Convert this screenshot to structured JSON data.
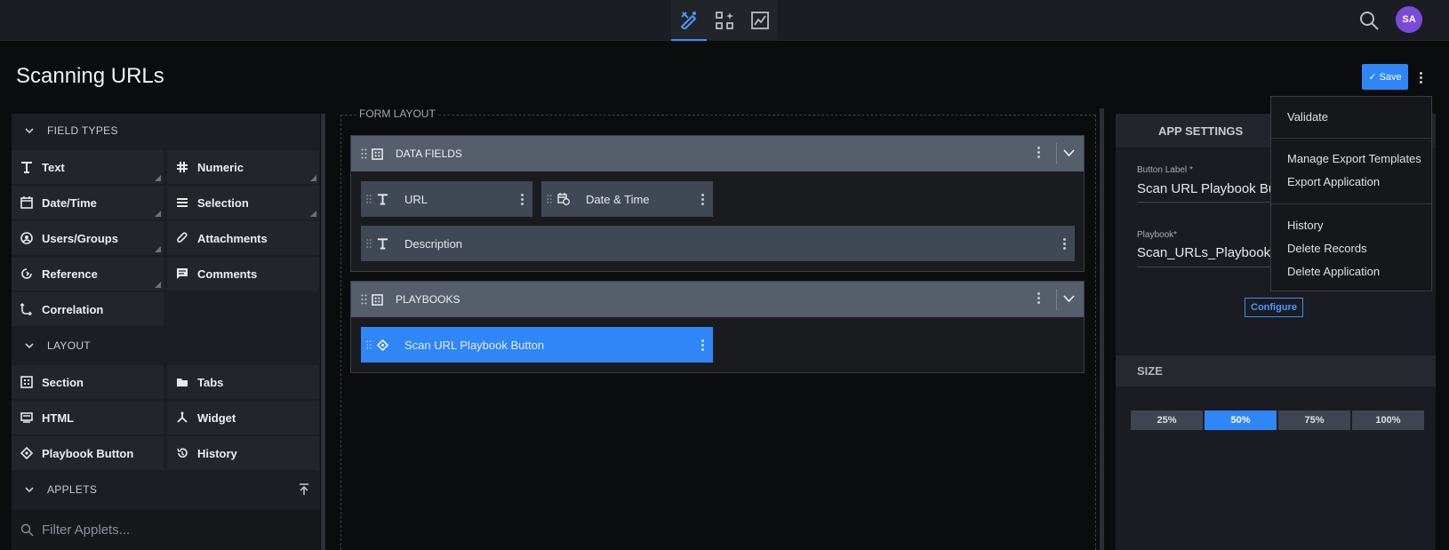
{
  "header": {
    "nav_icons": [
      "form-designer-icon",
      "workflow-icon",
      "reports-icon"
    ],
    "avatar_initials": "SA"
  },
  "page": {
    "title": "Scanning URLs",
    "save_label": "Save"
  },
  "palette": {
    "field_types_label": "FIELD TYPES",
    "field_types": [
      {
        "label": "Text",
        "icon": "text-icon"
      },
      {
        "label": "Numeric",
        "icon": "hash-icon"
      },
      {
        "label": "Date/Time",
        "icon": "calendar-icon"
      },
      {
        "label": "Selection",
        "icon": "list-icon"
      },
      {
        "label": "Users/Groups",
        "icon": "user-icon"
      },
      {
        "label": "Attachments",
        "icon": "paperclip-icon"
      },
      {
        "label": "Reference",
        "icon": "reference-icon"
      },
      {
        "label": "Comments",
        "icon": "comment-icon"
      },
      {
        "label": "Correlation",
        "icon": "correlation-icon"
      }
    ],
    "layout_label": "LAYOUT",
    "layout_items": [
      {
        "label": "Section",
        "icon": "section-icon"
      },
      {
        "label": "Tabs",
        "icon": "tabs-icon"
      },
      {
        "label": "HTML",
        "icon": "html-icon"
      },
      {
        "label": "Widget",
        "icon": "widget-icon"
      },
      {
        "label": "Playbook Button",
        "icon": "playbook-icon"
      },
      {
        "label": "History",
        "icon": "history-icon"
      }
    ],
    "applets_label": "APPLETS",
    "filter_placeholder": "Filter Applets..."
  },
  "form": {
    "label": "FORM LAYOUT",
    "sections": [
      {
        "title": "DATA FIELDS",
        "fields": [
          {
            "label": "URL",
            "icon": "text-icon"
          },
          {
            "label": "Date & Time",
            "icon": "calendar-clock-icon"
          },
          {
            "label": "Description",
            "icon": "text-icon"
          }
        ]
      },
      {
        "title": "PLAYBOOKS",
        "fields": [
          {
            "label": "Scan URL Playbook Button",
            "icon": "playbook-icon",
            "selected": true
          }
        ]
      }
    ]
  },
  "settings": {
    "title": "APP SETTINGS",
    "button_label_label": "Button Label",
    "button_label_required": "*",
    "button_label_value": "Scan URL Playbook Butt",
    "playbook_label": "Playbook*",
    "playbook_value": "Scan_URLs_Playbook",
    "configure_label": "Configure",
    "size_label": "SIZE",
    "sizes": [
      "25%",
      "50%",
      "75%",
      "100%"
    ],
    "size_selected": "50%"
  },
  "menu": {
    "items": [
      "Validate",
      "Manage Export Templates",
      "Export Application",
      "History",
      "Delete Records",
      "Delete Application"
    ]
  },
  "colors": {
    "accent": "#2f86f6",
    "avatar": "#7b4ad6",
    "section_header": "#565d6b"
  }
}
